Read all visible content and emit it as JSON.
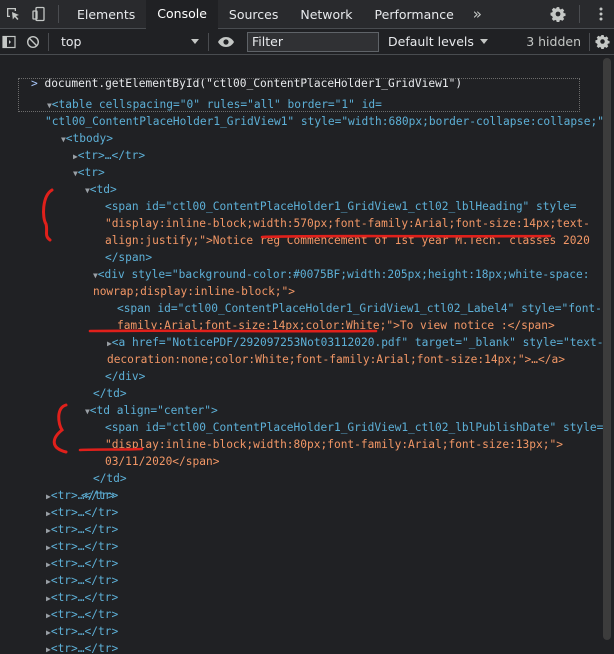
{
  "tabbar": {
    "tabs": [
      "Elements",
      "Console",
      "Sources",
      "Network",
      "Performance"
    ],
    "active_tab": "Console",
    "more": "»"
  },
  "toolbar": {
    "context": "top",
    "filter_placeholder": "Filter",
    "levels_label": "Default levels",
    "hidden_count": "3 hidden"
  },
  "console": {
    "prompt": ">",
    "command": "document.getElementById(\"ctl00_ContentPlaceHolder1_GridView1\")",
    "lines": {
      "table_open_1": "<table cellspacing=\"0\" rules=\"all\" border=\"1\" id=",
      "table_open_2": "\"ctl00_ContentPlaceHolder1_GridView1\" style=\"width:680px;border-collapse:collapse;\">",
      "tbody": "<tbody>",
      "tr_collapsed": "<tr>…</tr>",
      "tr_open": "<tr>",
      "td_open": "<td>",
      "span_heading_1": "<span id=\"ctl00_ContentPlaceHolder1_GridView1_ctl02_lblHeading\" style=",
      "span_heading_2": "\"display:inline-block;width:570px;font-family:Arial;font-size:14px;text-",
      "span_heading_3": "align:justify;\">Notice reg Commencement of 1st year M.Tech. classes 2020",
      "span_close": "</span>",
      "div_1": "<div style=\"background-color:#0075BF;width:205px;height:18px;white-space:",
      "div_2": "nowrap;display:inline-block;\">",
      "span_label_1": "<span id=\"ctl00_ContentPlaceHolder1_GridView1_ctl02_Label4\" style=\"font-",
      "span_label_2": "family:Arial;font-size:14px;color:White;\">To view notice :</span>",
      "a_1": "<a href=\"NoticePDF/292097253Not03112020.pdf\" target=\"_blank\" style=\"text-",
      "a_2": "decoration:none;color:White;font-family:Arial;font-size:14px;\">…</a>",
      "div_close": "</div>",
      "td_close": "</td>",
      "td_center": "<td align=\"center\">",
      "span_date_1": "<span id=\"ctl00_ContentPlaceHolder1_GridView1_ctl02_lblPublishDate\" style=",
      "span_date_2": "\"display:inline-block;width:80px;font-family:Arial;font-size:13px;\">",
      "span_date_3": "03/11/2020</span>",
      "tr_close": "</tr>"
    },
    "heading_text": "Notice reg Commencement of 1st year M.Tech. classes 2020",
    "label_text": "To view notice :",
    "href_value": "NoticePDF/292097253Not03112020.pdf",
    "publish_date": "03/11/2020"
  },
  "colors": {
    "tag": "#5db0d7",
    "attr_name": "#9bbbdc",
    "attr_value": "#f29766",
    "annotation_red": "#e0201b"
  }
}
